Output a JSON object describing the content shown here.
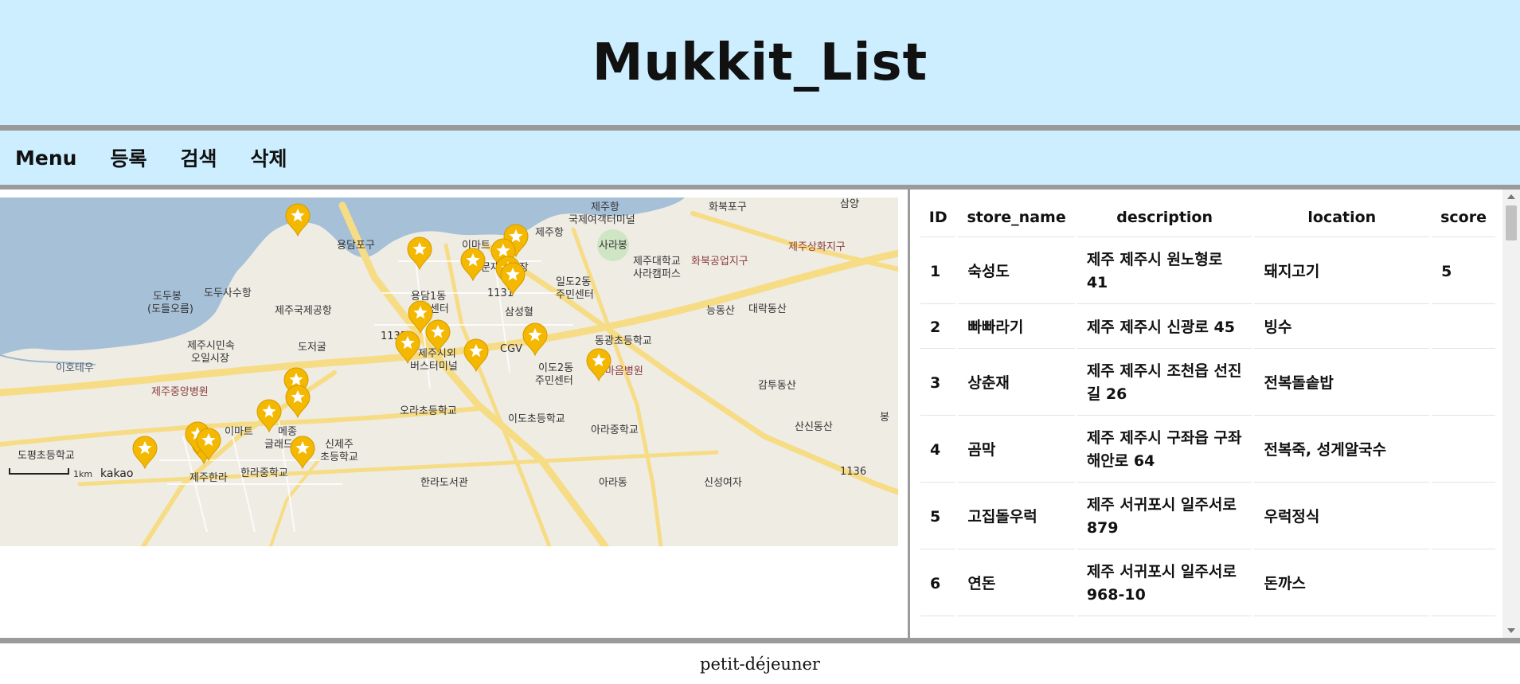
{
  "header": {
    "title": "Mukkit_List"
  },
  "nav": {
    "items": [
      "Menu",
      "등록",
      "검색",
      "삭제"
    ]
  },
  "map": {
    "scale_label": "1km",
    "attribution": "kakao",
    "place_labels": [
      "제주항",
      "국제여객터미널",
      "화북포구",
      "삼양",
      "용담포구",
      "이마트",
      "제주항",
      "사라봉",
      "제주대학교",
      "사라캠퍼스",
      "화북공업지구",
      "제주상화지구",
      "동문재래시장",
      "일도2동",
      "주민센터",
      "용담1동",
      "주민센터",
      "도두봉",
      "(도들오름)",
      "도두사수항",
      "제주국제공항",
      "삼성혈",
      "능동산",
      "대락동산",
      "제주시민속",
      "오일시장",
      "도저굴",
      "CGV",
      "동광초등학교",
      "이호테우",
      "제주시외",
      "버스터미널",
      "이도2동",
      "주민센터",
      "한마음병원",
      "제주중앙병원",
      "감투동산",
      "오라초등학교",
      "이도초등학교",
      "산신동산",
      "아라중학교",
      "이마트",
      "메종",
      "글래드",
      "신제주",
      "초등학교",
      "도평초등학교",
      "제주한라",
      "한라중학교",
      "한라도서관",
      "아라동",
      "신성여자",
      "1136",
      "1131",
      "1132",
      "봉"
    ]
  },
  "table": {
    "columns": [
      "ID",
      "store_name",
      "description",
      "location",
      "score"
    ],
    "rows": [
      {
        "id": "1",
        "store_name": "숙성도",
        "description": "제주 제주시 원노형로 41",
        "location": "돼지고기",
        "score": "5"
      },
      {
        "id": "2",
        "store_name": "빠빠라기",
        "description": "제주 제주시 신광로 45",
        "location": "빙수",
        "score": ""
      },
      {
        "id": "3",
        "store_name": "상춘재",
        "description": "제주 제주시 조천읍 선진길 26",
        "location": "전복돌솥밥",
        "score": ""
      },
      {
        "id": "4",
        "store_name": "곰막",
        "description": "제주 제주시 구좌읍 구좌해안로 64",
        "location": "전복죽, 성게알국수",
        "score": ""
      },
      {
        "id": "5",
        "store_name": "고집돌우럭",
        "description": "제주 서귀포시 일주서로 879",
        "location": "우럭정식",
        "score": ""
      },
      {
        "id": "6",
        "store_name": "연돈",
        "description": "제주 서귀포시 일주서로 968-10",
        "location": "돈까스",
        "score": ""
      }
    ]
  },
  "footer": {
    "text": "petit-déjeuner"
  },
  "colors": {
    "header_bg": "#cceeff",
    "marker": "#f5b800",
    "sea": "#a6c0d8",
    "land": "#efece4",
    "road": "#f7dc86"
  }
}
